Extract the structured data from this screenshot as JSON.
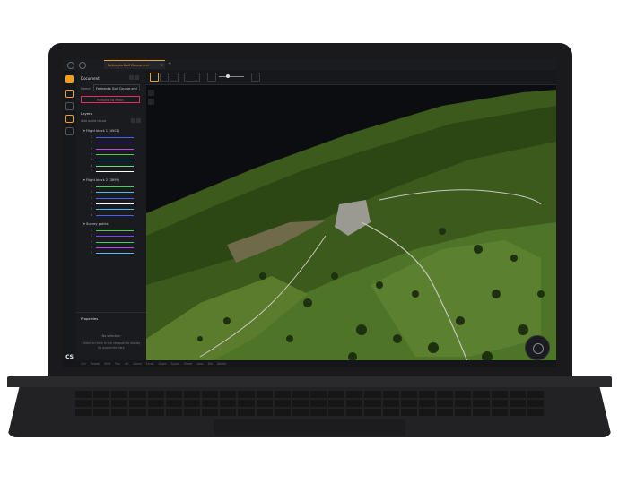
{
  "titlebar": {
    "tab_label": "Fairbanks Golf Course.xml",
    "new_tab": "+"
  },
  "sidebar": {
    "title": "Document",
    "name_label": "Name",
    "name_value": "Fairbanks Golf Course.xml",
    "primary_button": "Rebuild 3D Mesh",
    "layers_title": "Layers",
    "layers_sub": "Add point cloud",
    "groups": [
      {
        "label": "Flight block 1 (4001)",
        "layers": [
          {
            "n": "1",
            "color": "#4060ff"
          },
          {
            "n": "2",
            "color": "#8040ff"
          },
          {
            "n": "3",
            "color": "#c040ff"
          },
          {
            "n": "4",
            "color": "#40d060"
          },
          {
            "n": "5",
            "color": "#40c0ff"
          },
          {
            "n": "6",
            "color": "#60e080"
          },
          {
            "n": "7",
            "color": "#ffffff"
          }
        ]
      },
      {
        "label": "Flight block 2 (3899)",
        "layers": [
          {
            "n": "1",
            "color": "#40d060"
          },
          {
            "n": "2",
            "color": "#40c0ff"
          },
          {
            "n": "3",
            "color": "#4060ff"
          },
          {
            "n": "4",
            "color": "#ffffff"
          },
          {
            "n": "5",
            "color": "#40c0ff"
          },
          {
            "n": "6",
            "color": "#4060ff"
          }
        ]
      },
      {
        "label": "Survey points",
        "layers": [
          {
            "n": "1",
            "color": "#40d060"
          },
          {
            "n": "2",
            "color": "#8040ff"
          },
          {
            "n": "3",
            "color": "#40d060"
          },
          {
            "n": "4",
            "color": "#c040ff"
          },
          {
            "n": "5",
            "color": "#40c0ff"
          }
        ]
      }
    ]
  },
  "properties": {
    "title": "Properties",
    "empty_title": "No selection",
    "empty_body": "Select an item in the viewport to display its properties here"
  },
  "rail": {
    "logo": "CS"
  },
  "statusbar": {
    "text": "Ctrl Rotate  Shift Pan  Alt Zoom  Scroll Zoom  Space Reset view  Del Delete"
  },
  "colors": {
    "accent": "#f0a020",
    "danger": "#e03060"
  }
}
